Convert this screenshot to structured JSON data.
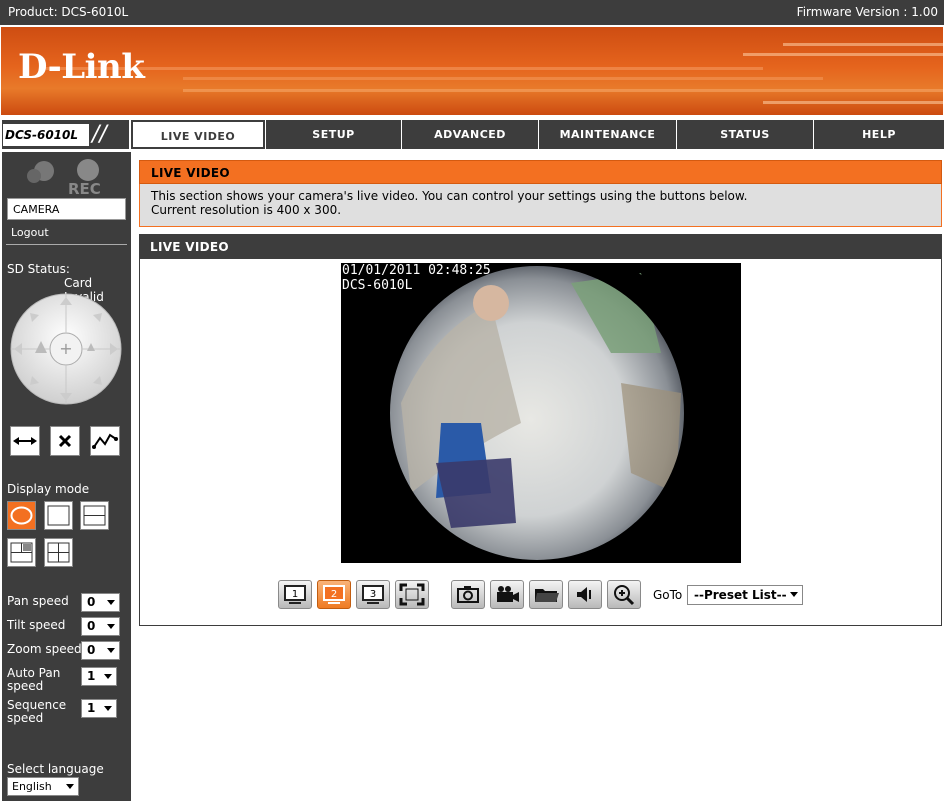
{
  "topbar": {
    "product": "Product: DCS-6010L",
    "firmware": "Firmware Version : 1.00"
  },
  "brand": {
    "logo": "D-Link",
    "colors": {
      "banner": "#e5641d",
      "dark": "#3d3d3d",
      "accent": "#f37021"
    }
  },
  "nav": {
    "model": "DCS-6010L",
    "tabs": [
      {
        "label": "LIVE VIDEO",
        "active": true
      },
      {
        "label": "SETUP"
      },
      {
        "label": "ADVANCED"
      },
      {
        "label": "MAINTENANCE"
      },
      {
        "label": "STATUS"
      },
      {
        "label": "HELP"
      }
    ]
  },
  "sidebar": {
    "rec_label": "REC",
    "camera_item": "CAMERA",
    "logout": "Logout",
    "sd_status_label": "SD Status:",
    "sd_status_value": "Card Invalid",
    "display_mode_label": "Display mode",
    "speeds": [
      {
        "label": "Pan speed",
        "value": "0"
      },
      {
        "label": "Tilt speed",
        "value": "0"
      },
      {
        "label": "Zoom speed",
        "value": "0"
      },
      {
        "label": "Auto Pan speed",
        "value": "1"
      },
      {
        "label": "Sequence speed",
        "value": "1"
      }
    ],
    "language_label": "Select language",
    "language_value": "English"
  },
  "section1": {
    "title": "LIVE VIDEO",
    "line1": "This section shows your camera's live video. You can control your settings using the buttons below.",
    "line2": "Current resolution is 400 x 300."
  },
  "section2": {
    "title": "LIVE VIDEO",
    "osd_datetime": "01/01/2011 02:48:25",
    "osd_name": "DCS-6010L",
    "stream_buttons": [
      "1",
      "2",
      "3"
    ],
    "active_stream": "2",
    "goto_label": "GoTo",
    "preset_value": "--Preset List--"
  }
}
